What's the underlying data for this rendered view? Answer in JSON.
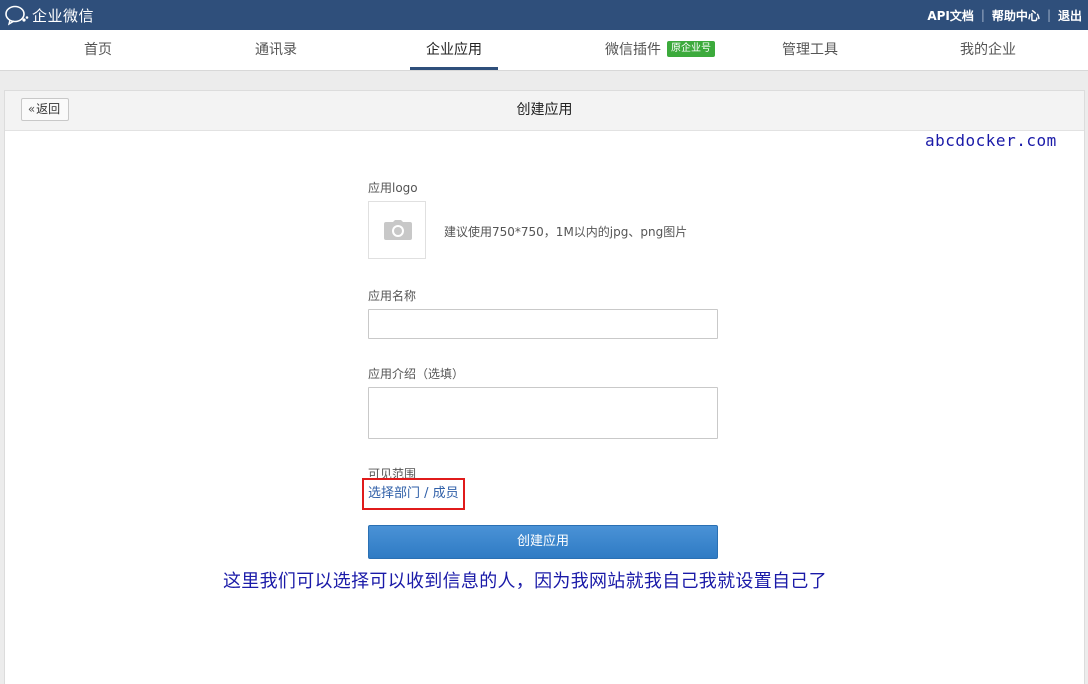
{
  "topbar": {
    "brand": "企业微信",
    "links": [
      "API文档",
      "帮助中心",
      "退出"
    ]
  },
  "nav": {
    "items": [
      {
        "label": "首页"
      },
      {
        "label": "通讯录"
      },
      {
        "label": "企业应用",
        "active": true
      },
      {
        "label": "微信插件",
        "badge": "原企业号"
      },
      {
        "label": "管理工具"
      },
      {
        "label": "我的企业"
      }
    ]
  },
  "panel": {
    "back_label": "返回",
    "title": "创建应用",
    "watermark": "abcdocker.com"
  },
  "form": {
    "logo_label": "应用logo",
    "logo_hint": "建议使用750*750，1M以内的jpg、png图片",
    "name_label": "应用名称",
    "name_value": "",
    "intro_label": "应用介绍（选填）",
    "intro_value": "",
    "visibility_label": "可见范围",
    "visibility_link": "选择部门 / 成员",
    "submit_label": "创建应用"
  },
  "annotation": "这里我们可以选择可以收到信息的人，因为我网站就我自己我就设置自己了",
  "colors": {
    "topbar": "#2f4f7b",
    "primary_button": "#3684cd",
    "highlight_box": "#e01b1b",
    "annotation_text": "#1a1aa8",
    "badge": "#3caa3c"
  }
}
